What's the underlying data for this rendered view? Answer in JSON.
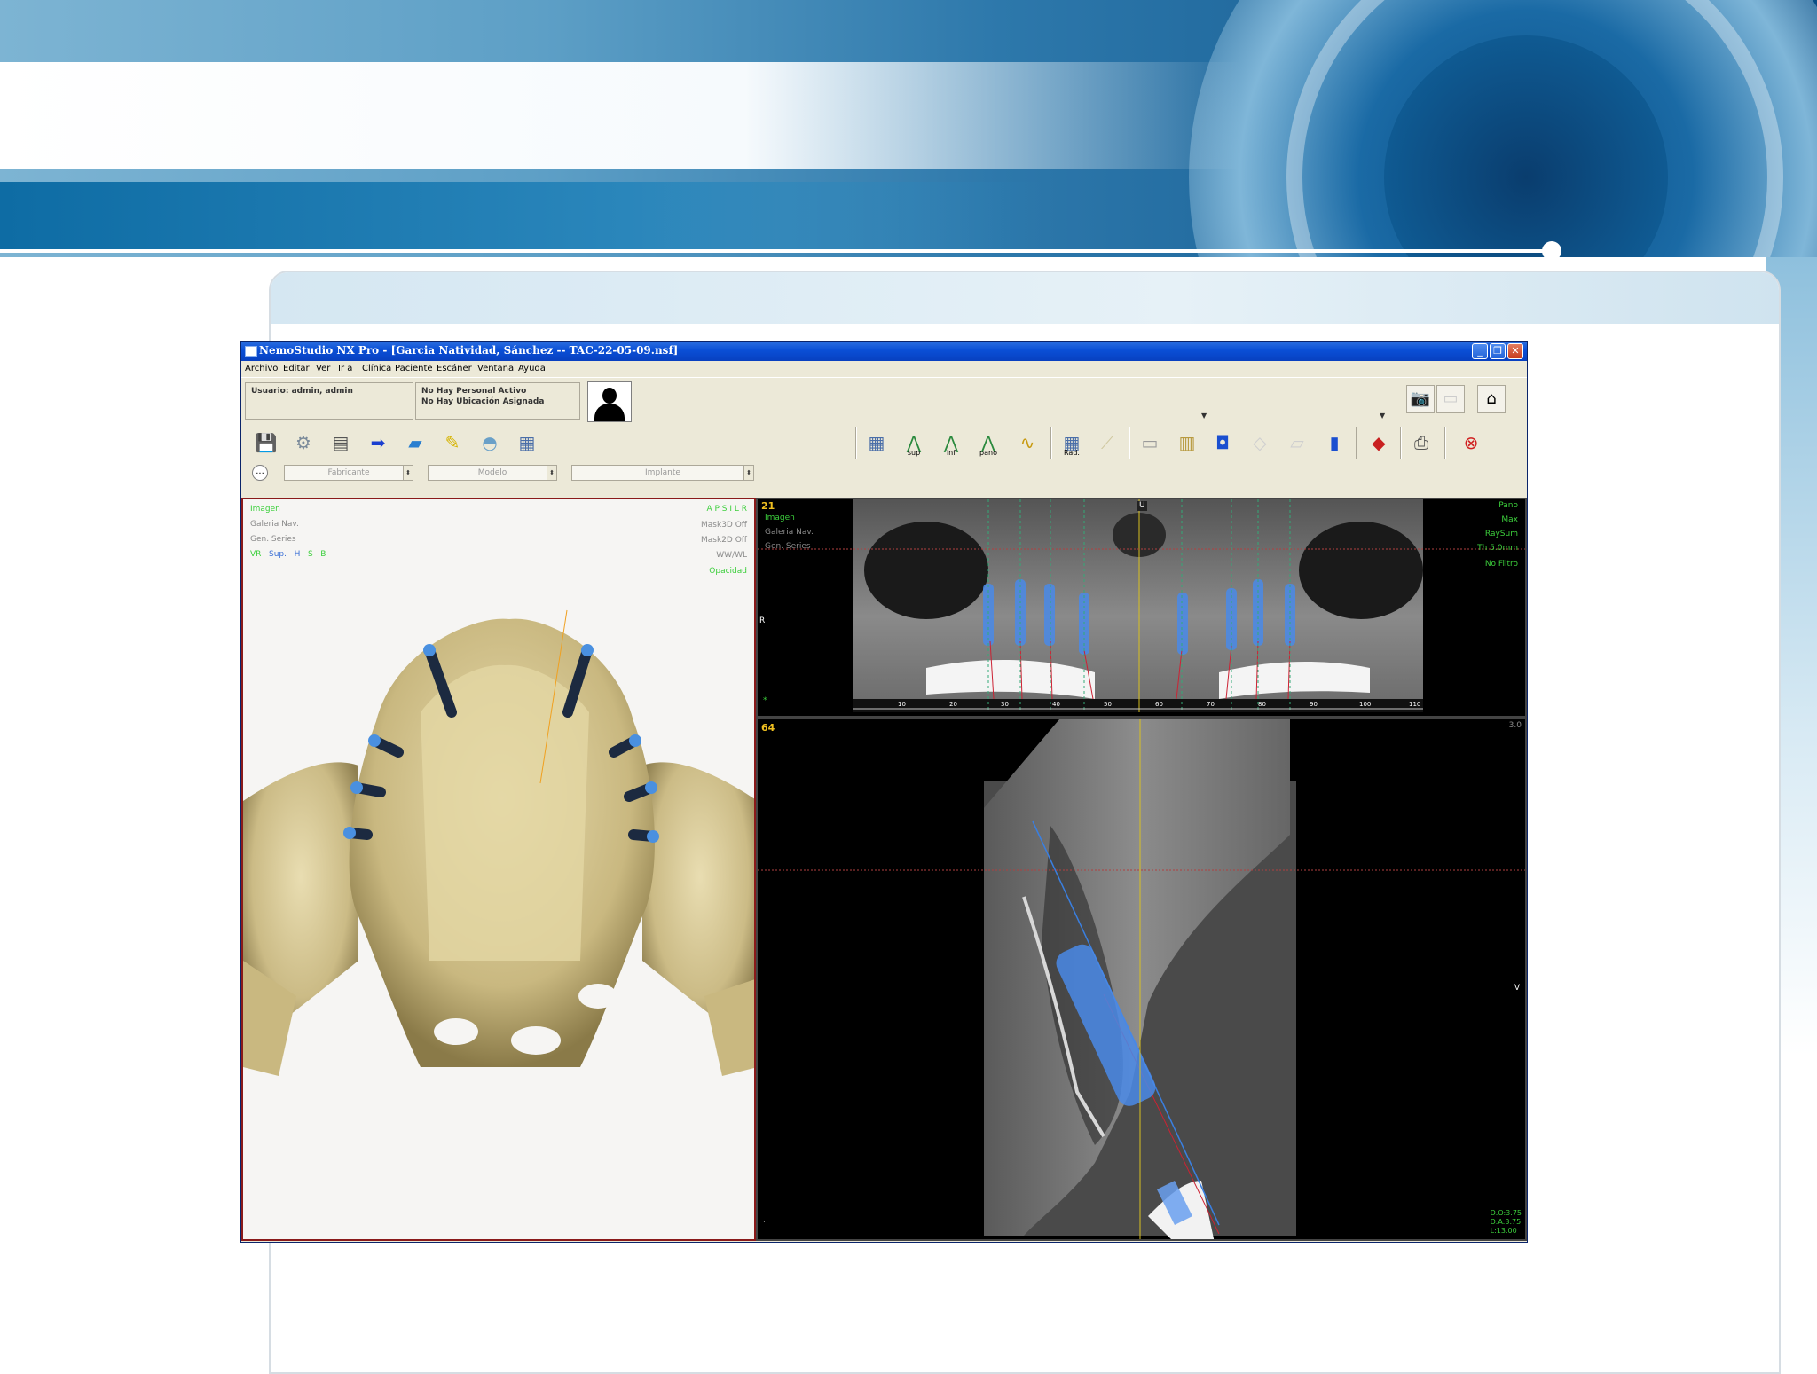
{
  "app": {
    "title": "NemoStudio NX Pro - [Garcia Natividad, Sánchez -- TAC-22-05-09.nsf]",
    "window_buttons": [
      "_",
      "❐",
      "✕"
    ]
  },
  "menu": [
    "Archivo",
    "Editar",
    "Ver",
    "Ir a",
    "Clínica",
    "Paciente",
    "Escáner",
    "Ventana",
    "Ayuda"
  ],
  "info": {
    "user": "Usuario: admin, admin",
    "personal": "No Hay Personal Activo",
    "location": "No Hay Ubicación Asignada"
  },
  "toolbar": {
    "sup": "sup",
    "inf": "inf",
    "pano": "pano",
    "rad": "Rad."
  },
  "selects": {
    "manufacturer": "Fabricante",
    "model": "Modelo",
    "implant": "Implante",
    "dot": "..."
  },
  "view3d": {
    "imagen": "Imagen",
    "galeria": "Galeria  Nav.",
    "gen": "Gen. Series",
    "vr": "VR",
    "sup": "Sup.",
    "h": "H",
    "s": "S",
    "b": "B",
    "orient": "A  P  S  I  L  R",
    "mask3d": "Mask3D Off",
    "mask2d": "Mask2D Off",
    "wwwl": "WW/WL",
    "opacidad": "Opacidad"
  },
  "pano": {
    "number": "21",
    "imagen": "Imagen",
    "galeria": "Galeria  Nav.",
    "gen": "Gen. Series",
    "r": "R",
    "u": "U",
    "star": "*",
    "pano": "Pano",
    "max": "Max",
    "raysum": "RaySum",
    "th": "Th 5.0mm",
    "filtro": "No Filtro",
    "ruler": [
      "10",
      "20",
      "30",
      "40",
      "50",
      "60",
      "70",
      "80",
      "90",
      "100",
      "110"
    ]
  },
  "cross": {
    "number": "64",
    "scale": "3.0",
    "v": "V",
    "do": "D.O:3.75",
    "da": "D.A:3.75",
    "l": "L:13.00",
    "dot": "."
  }
}
